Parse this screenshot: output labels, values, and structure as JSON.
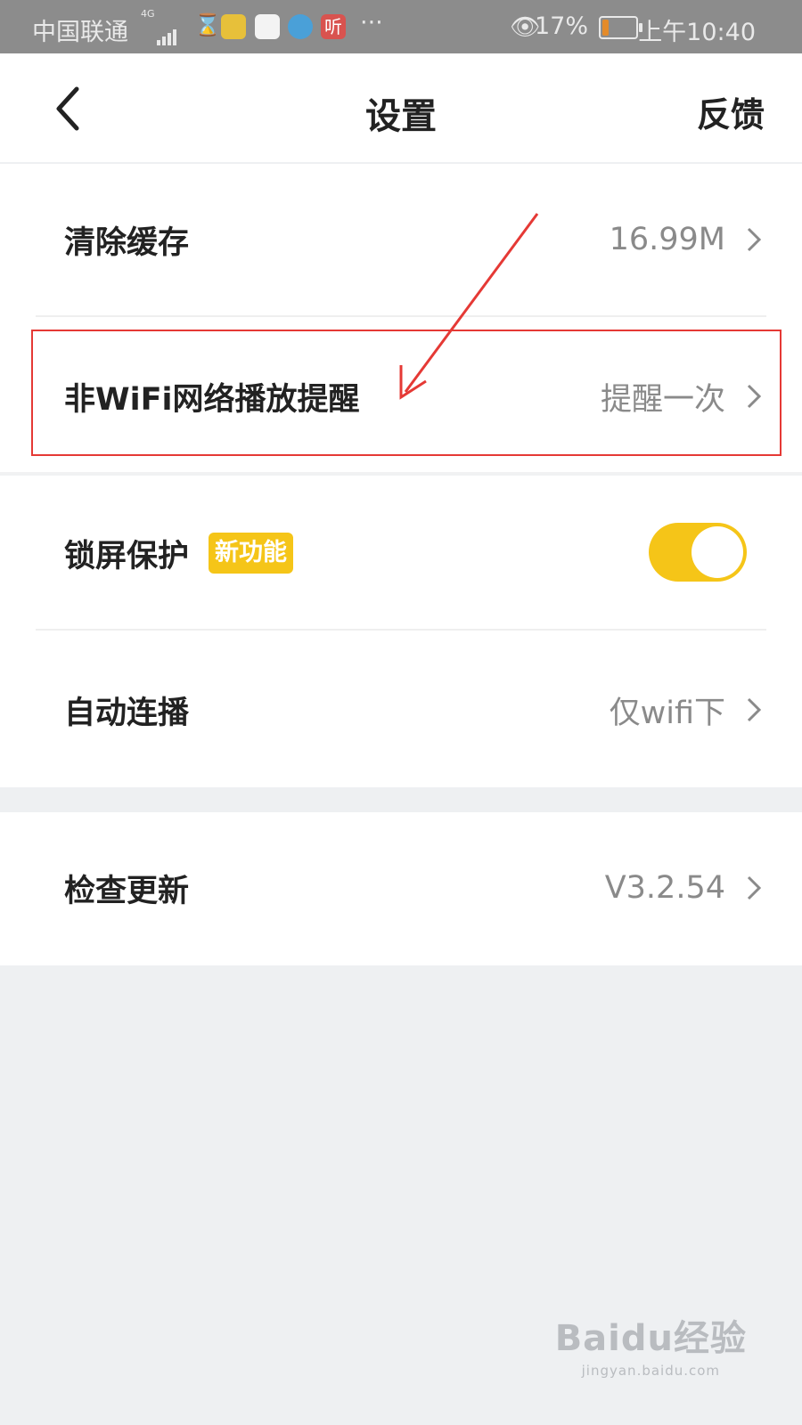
{
  "status_bar": {
    "carrier": "中国联通",
    "network": "4G",
    "listen_icon_text": "听",
    "dots": "···",
    "battery": "17%",
    "time": "上午10:40"
  },
  "header": {
    "title": "设置",
    "feedback": "反馈"
  },
  "settings": {
    "clear_cache": {
      "label": "清除缓存",
      "value": "16.99M"
    },
    "non_wifi": {
      "label": "非WiFi网络播放提醒",
      "value": "提醒一次"
    },
    "lock_screen": {
      "label": "锁屏保护",
      "badge": "新功能",
      "enabled": true
    },
    "autoplay": {
      "label": "自动连播",
      "value": "仅wifi下"
    },
    "update": {
      "label": "检查更新",
      "value": "V3.2.54"
    }
  },
  "colors": {
    "accent": "#f5c518",
    "highlight": "#e53935"
  },
  "watermark": {
    "brand": "Baidu经验",
    "url": "jingyan.baidu.com"
  }
}
